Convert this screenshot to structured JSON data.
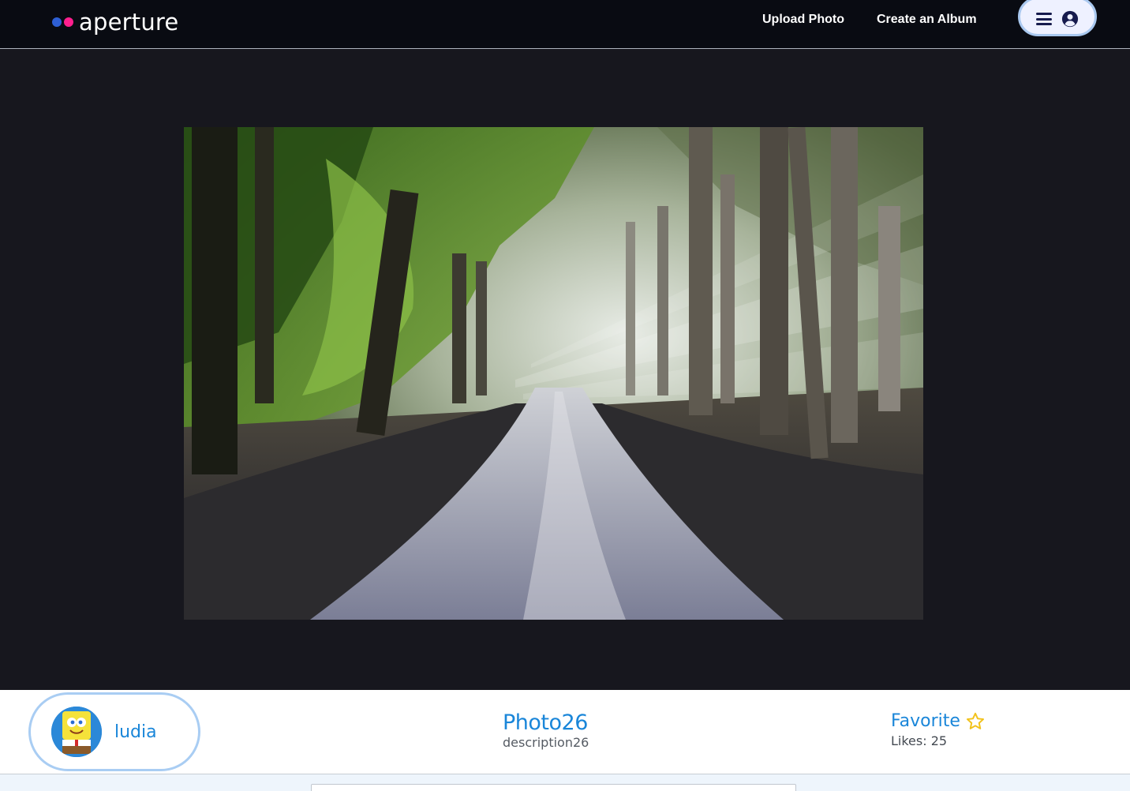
{
  "header": {
    "brand": "aperture",
    "nav": {
      "upload_photo": "Upload Photo",
      "create_album": "Create an Album"
    },
    "menu_icon": "bars-icon",
    "account_icon": "user-circle-icon",
    "colors": {
      "background": "#090b12",
      "dot_blue": "#2e5fd4",
      "dot_pink": "#ff1f8e"
    }
  },
  "photo": {
    "alt": "Photo26",
    "subject": "forest dirt road with sun rays"
  },
  "info": {
    "username": "ludia",
    "title": "Photo26",
    "description": "description26",
    "favorite_label": "Favorite",
    "favorite_icon": "star-outline-icon",
    "likes_text": "Likes: 25",
    "likes": 25,
    "accent_color": "#1a86d9"
  },
  "comment": {
    "placeholder": ""
  }
}
